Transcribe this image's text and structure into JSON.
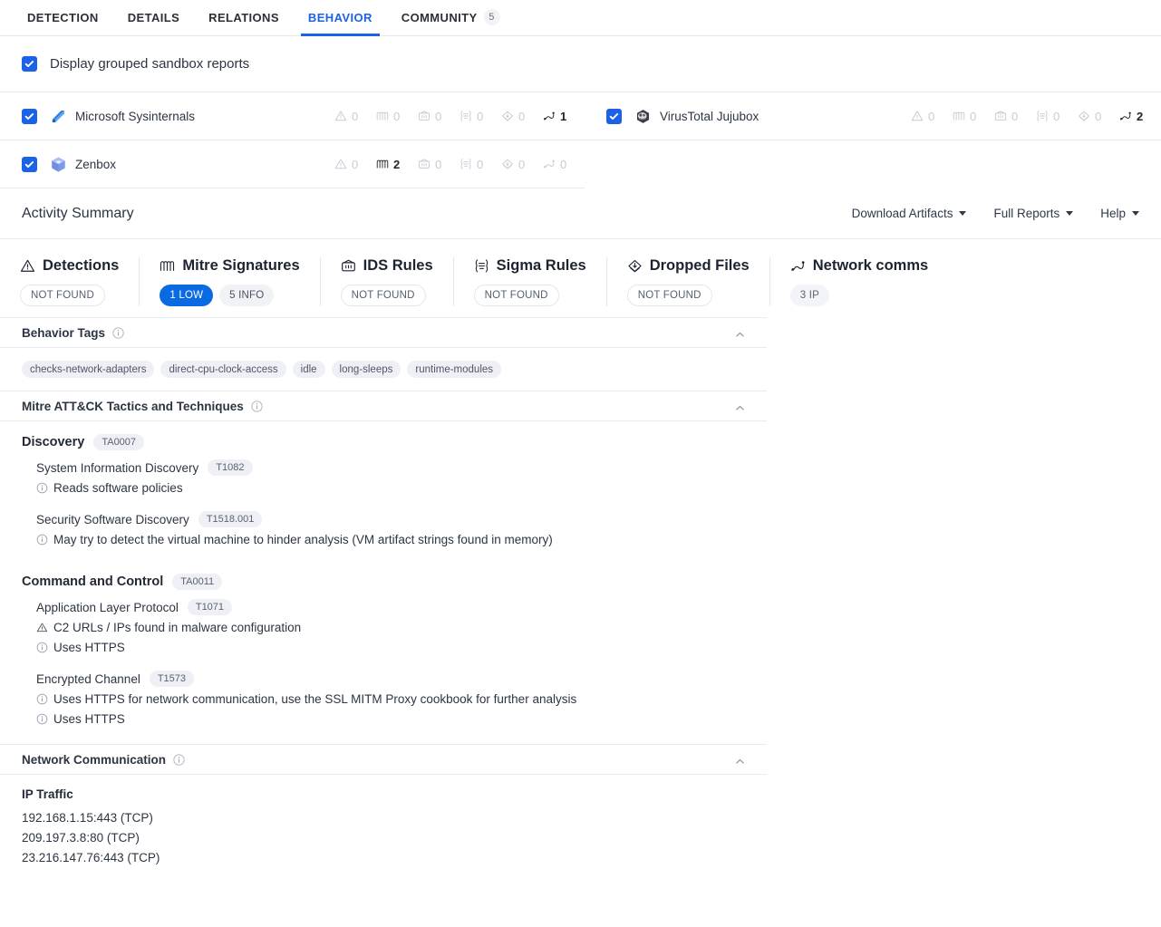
{
  "tabs": [
    {
      "label": "DETECTION",
      "active": false
    },
    {
      "label": "DETAILS",
      "active": false
    },
    {
      "label": "RELATIONS",
      "active": false
    },
    {
      "label": "BEHAVIOR",
      "active": true
    },
    {
      "label": "COMMUNITY",
      "active": false,
      "count": "5"
    }
  ],
  "grouped": {
    "label": "Display grouped sandbox reports",
    "checked": true
  },
  "sandboxes": [
    {
      "name": "Microsoft Sysinternals",
      "checked": true,
      "logo": "sysinternals-logo",
      "stats": [
        {
          "icon": "detections-icon",
          "value": "0",
          "highlight": false
        },
        {
          "icon": "mitre-icon",
          "value": "0",
          "highlight": false
        },
        {
          "icon": "ids-icon",
          "value": "0",
          "highlight": false
        },
        {
          "icon": "sigma-icon",
          "value": "0",
          "highlight": false
        },
        {
          "icon": "dropped-files-icon",
          "value": "0",
          "highlight": false
        },
        {
          "icon": "network-icon",
          "value": "1",
          "highlight": true
        }
      ]
    },
    {
      "name": "VirusTotal Jujubox",
      "checked": true,
      "logo": "jujubox-logo",
      "stats": [
        {
          "icon": "detections-icon",
          "value": "0",
          "highlight": false
        },
        {
          "icon": "mitre-icon",
          "value": "0",
          "highlight": false
        },
        {
          "icon": "ids-icon",
          "value": "0",
          "highlight": false
        },
        {
          "icon": "sigma-icon",
          "value": "0",
          "highlight": false
        },
        {
          "icon": "dropped-files-icon",
          "value": "0",
          "highlight": false
        },
        {
          "icon": "network-icon",
          "value": "2",
          "highlight": true
        }
      ]
    },
    {
      "name": "Zenbox",
      "checked": true,
      "logo": "zenbox-logo",
      "stats": [
        {
          "icon": "detections-icon",
          "value": "0",
          "highlight": false
        },
        {
          "icon": "mitre-icon",
          "value": "2",
          "highlight": true
        },
        {
          "icon": "ids-icon",
          "value": "0",
          "highlight": false
        },
        {
          "icon": "sigma-icon",
          "value": "0",
          "highlight": false
        },
        {
          "icon": "dropped-files-icon",
          "value": "0",
          "highlight": false
        },
        {
          "icon": "network-icon",
          "value": "0",
          "highlight": false
        }
      ]
    }
  ],
  "activity": {
    "title": "Activity Summary",
    "actions": [
      {
        "label": "Download Artifacts"
      },
      {
        "label": "Full Reports"
      },
      {
        "label": "Help"
      }
    ]
  },
  "cards": [
    {
      "title": "Detections",
      "icon": "detections-icon",
      "badges": [
        {
          "text": "NOT FOUND",
          "style": "outline"
        }
      ]
    },
    {
      "title": "Mitre Signatures",
      "icon": "mitre-icon",
      "badges": [
        {
          "text": "1 LOW",
          "style": "blue"
        },
        {
          "text": "5 INFO",
          "style": "grey"
        }
      ]
    },
    {
      "title": "IDS Rules",
      "icon": "ids-icon",
      "badges": [
        {
          "text": "NOT FOUND",
          "style": "outline"
        }
      ]
    },
    {
      "title": "Sigma Rules",
      "icon": "sigma-icon",
      "badges": [
        {
          "text": "NOT FOUND",
          "style": "outline"
        }
      ]
    },
    {
      "title": "Dropped Files",
      "icon": "dropped-files-icon",
      "badges": [
        {
          "text": "NOT FOUND",
          "style": "outline"
        }
      ]
    },
    {
      "title": "Network comms",
      "icon": "network-icon",
      "badges": [
        {
          "text": "3 IP",
          "style": "soft"
        }
      ]
    }
  ],
  "behavior_tags": {
    "title": "Behavior Tags",
    "tags": [
      "checks-network-adapters",
      "direct-cpu-clock-access",
      "idle",
      "long-sleeps",
      "runtime-modules"
    ]
  },
  "mitre": {
    "title": "Mitre ATT&CK Tactics and Techniques",
    "tactics": [
      {
        "name": "Discovery",
        "code": "TA0007",
        "techniques": [
          {
            "name": "System Information Discovery",
            "code": "T1082",
            "items": [
              {
                "severity": "info",
                "text": "Reads software policies"
              }
            ]
          },
          {
            "name": "Security Software Discovery",
            "code": "T1518.001",
            "items": [
              {
                "severity": "info",
                "text": "May try to detect the virtual machine to hinder analysis (VM artifact strings found in memory)"
              }
            ]
          }
        ]
      },
      {
        "name": "Command and Control",
        "code": "TA0011",
        "techniques": [
          {
            "name": "Application Layer Protocol",
            "code": "T1071",
            "items": [
              {
                "severity": "warning",
                "text": "C2 URLs / IPs found in malware configuration"
              },
              {
                "severity": "info",
                "text": "Uses HTTPS"
              }
            ]
          },
          {
            "name": "Encrypted Channel",
            "code": "T1573",
            "items": [
              {
                "severity": "info",
                "text": "Uses HTTPS for network communication, use the SSL MITM Proxy cookbook for further analysis"
              },
              {
                "severity": "info",
                "text": "Uses HTTPS"
              }
            ]
          }
        ]
      }
    ]
  },
  "network": {
    "title": "Network Communication",
    "subhead": "IP Traffic",
    "ips": [
      "192.168.1.15:443 (TCP)",
      "209.197.3.8:80 (TCP)",
      "23.216.147.76:443 (TCP)"
    ]
  },
  "colors": {
    "accent": "#1b62e8",
    "badge_blue": "#0a6ae1",
    "border": "#e7ebf0",
    "text": "#2c3542",
    "muted": "#c5cbd4"
  }
}
